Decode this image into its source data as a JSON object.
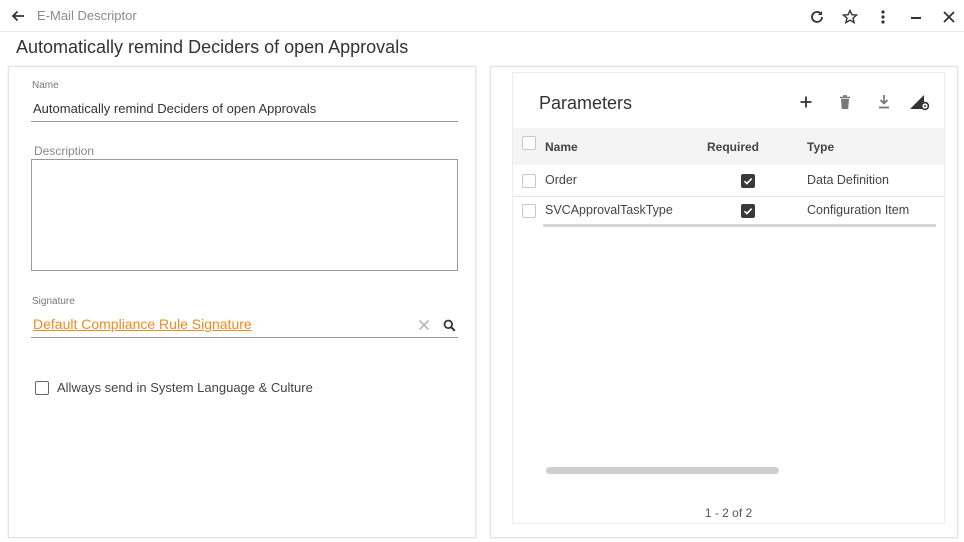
{
  "topbar": {
    "title": "E-Mail Descriptor",
    "back_icon": "arrow-left-icon",
    "actions": [
      "refresh-icon",
      "star-icon",
      "more-vert-icon",
      "minimize-icon",
      "close-icon"
    ]
  },
  "page": {
    "title": "Automatically remind Deciders of open Approvals"
  },
  "form": {
    "name_label": "Name",
    "name_value": "Automatically remind Deciders of open Approvals",
    "description_label": "Description",
    "description_value": "",
    "signature_label": "Signature",
    "signature_value": "Default Compliance Rule Signature",
    "always_send_label": "Allways send in System Language & Culture",
    "always_send_checked": false
  },
  "parameters": {
    "title": "Parameters",
    "toolbar": [
      "add-icon",
      "delete-icon",
      "download-icon",
      "column-settings-icon"
    ],
    "columns": [
      "Name",
      "Required",
      "Type"
    ],
    "rows": [
      {
        "name": "Order",
        "required": true,
        "type": "Data Definition"
      },
      {
        "name": "SVCApprovalTaskType",
        "required": true,
        "type": "Configuration Item"
      }
    ],
    "pager": "1 - 2 of 2"
  },
  "colors": {
    "accent": "#f08a1c",
    "text": "#333333",
    "header_bg": "#f4f4f4"
  }
}
